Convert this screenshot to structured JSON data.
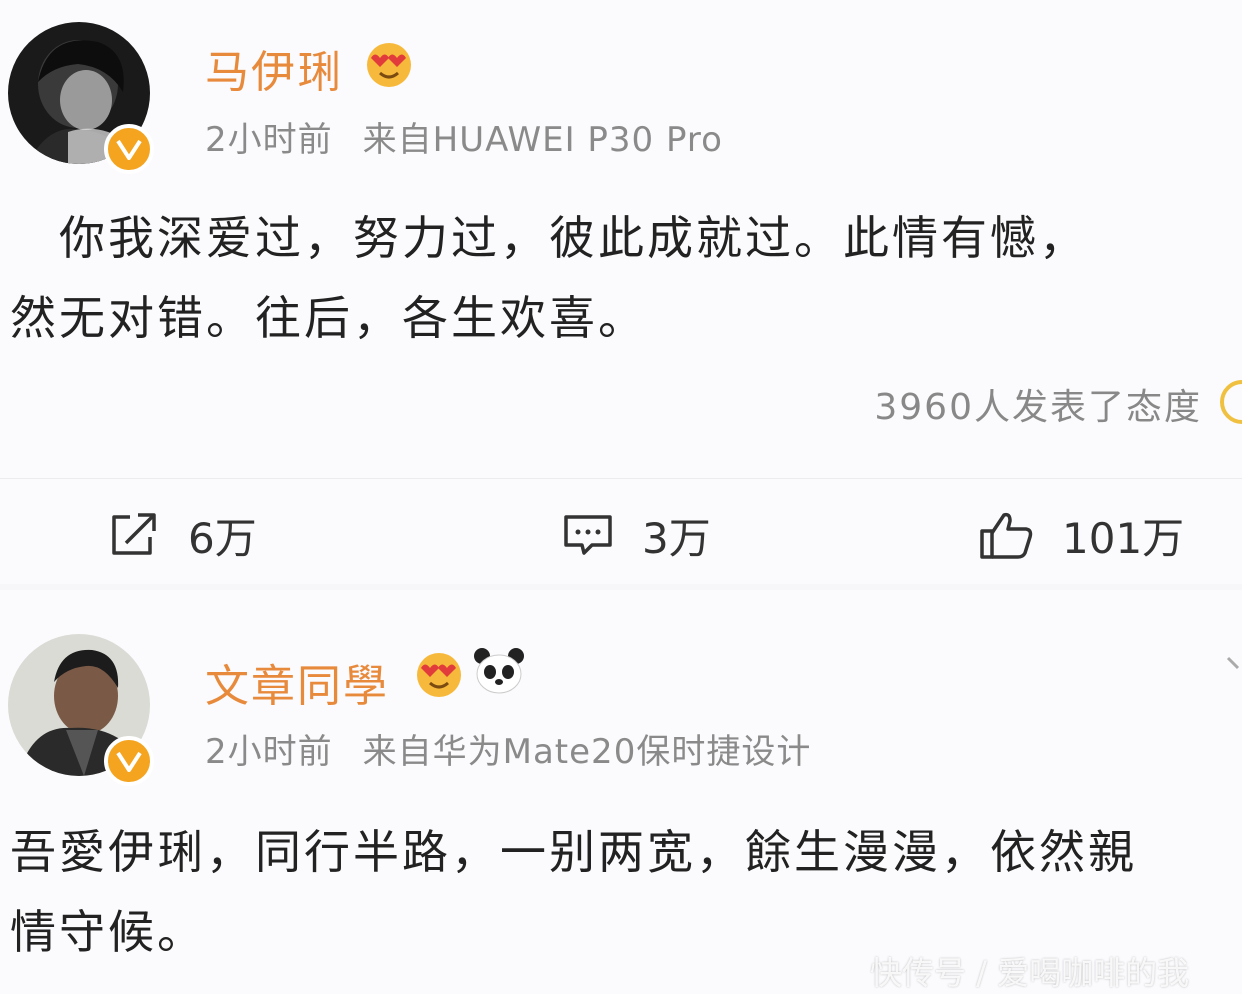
{
  "posts": [
    {
      "username": "马伊琍",
      "time": "2小时前",
      "source": "来自HUAWEI P30 Pro",
      "text_line1": "　你我深爱过，努力过，彼此成就过。此情有憾，",
      "text_line2": "然无对错。往后，各生欢喜。",
      "reactions": "3960人发表了态度",
      "repost_count": "6万",
      "comment_count": "3万",
      "like_count": "101万",
      "badges": [
        "heart-eyes-emoji"
      ]
    },
    {
      "username": "文章同學",
      "time": "2小时前",
      "source": "来自华为Mate20保时捷设计",
      "text_line1": "吾愛伊琍，同行半路，一别两宽，餘生漫漫，依然親",
      "text_line2": "情守候。",
      "badges": [
        "heart-eyes-emoji",
        "panda-emoji"
      ]
    }
  ],
  "watermark": "快传号 / 爱喝咖啡的我",
  "colors": {
    "username": "#e88a3c",
    "meta": "#8a8a8a",
    "verified_badge": "#f4a41f",
    "body_text": "#222222"
  }
}
